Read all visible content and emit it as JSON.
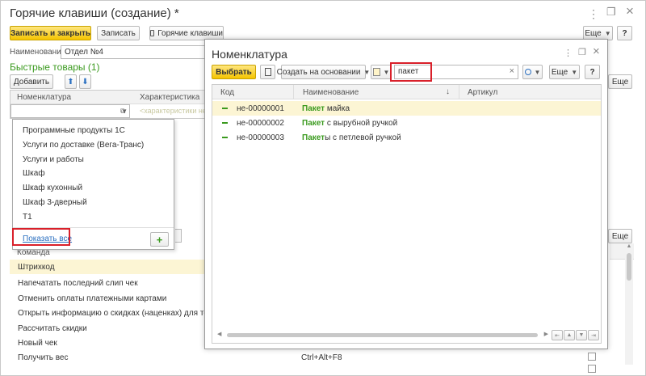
{
  "window": {
    "title": "Горячие клавиши (создание) *"
  },
  "window_controls": {
    "more": "⋮",
    "restore": "❐",
    "close": "×"
  },
  "toolbar": {
    "save_close": "Записать и закрыть",
    "save": "Записать",
    "hotkeys": "Горячие клавиши",
    "more": "Еще",
    "help": "?"
  },
  "form": {
    "name_label": "Наименование:",
    "name_value": "Отдел №4"
  },
  "quick_goods": {
    "title": "Быстрые товары (1)",
    "add": "Добавить",
    "col_item": "Номенклатура",
    "col_char": "Характеристика",
    "char_placeholder": "<характеристики не и"
  },
  "dropdown": {
    "items": [
      "Программные продукты 1С",
      "Услуги по доставке (Вега-Транс)",
      "Услуги и работы",
      "Шкаф",
      "Шкаф кухонный",
      "Шкаф 3-дверный",
      "Т1"
    ],
    "show_all": "Показать все",
    "add": "+"
  },
  "commands": {
    "header": "Команда",
    "rows": [
      {
        "name": "Штрихкод",
        "key": ""
      },
      {
        "name": "Напечатать последний слип чек",
        "key": ""
      },
      {
        "name": "Отменить оплаты платежными картами",
        "key": ""
      },
      {
        "name": "Открыть информацию о скидках (наценках) для текущей стр",
        "key": ""
      },
      {
        "name": "Рассчитать скидки",
        "key": ""
      },
      {
        "name": "Новый чек",
        "key": ""
      },
      {
        "name": "Получить вес",
        "key": "Ctrl+Alt+F8"
      }
    ]
  },
  "background_more": "Еще",
  "popup": {
    "title": "Номенклатура",
    "select": "Выбрать",
    "create_based": "Создать на основании",
    "search_value": "пакет",
    "clear": "×",
    "more": "Еще",
    "help": "?",
    "columns": {
      "code": "Код",
      "name": "Наименование",
      "article": "Артикул"
    },
    "sort_arrow": "↓",
    "rows": [
      {
        "code": "не-00000001",
        "highlight": "Пакет",
        "rest": " майка"
      },
      {
        "code": "не-00000002",
        "highlight": "Пакет",
        "rest": " с вырубной ручкой"
      },
      {
        "code": "не-00000003",
        "highlight": "Пакет",
        "rest": "ы с петлевой ручкой"
      }
    ],
    "nav": [
      "⇤",
      "▲",
      "▼",
      "⇥"
    ]
  },
  "colors": {
    "accent_yellow": "#f5c400",
    "highlight_row": "#fcf5d4",
    "green": "#3a9a1e",
    "red": "#d9202a"
  }
}
